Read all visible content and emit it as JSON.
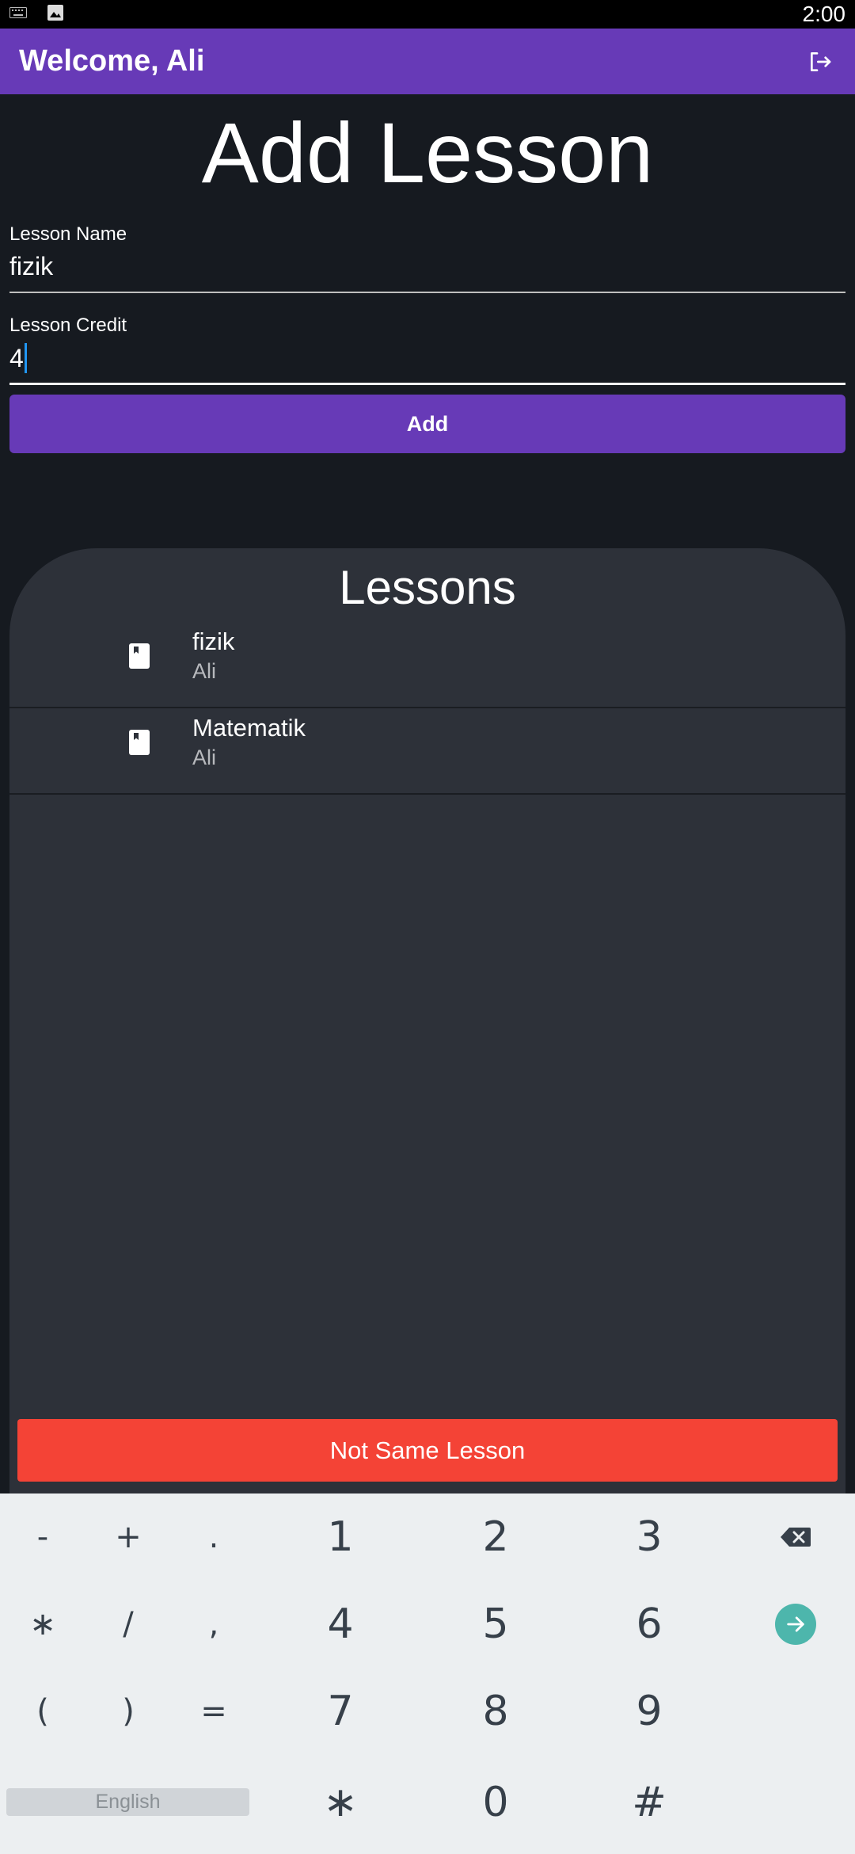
{
  "status_bar": {
    "time": "2:00",
    "icons": [
      "keyboard-icon",
      "image-icon"
    ]
  },
  "app_bar": {
    "title": "Welcome, Ali",
    "action_icon": "logout-icon",
    "color": "#673ab7"
  },
  "page": {
    "title": "Add Lesson"
  },
  "form": {
    "lesson_name": {
      "label": "Lesson Name",
      "value": "fizik"
    },
    "lesson_credit": {
      "label": "Lesson Credit",
      "value": "4"
    },
    "add_label": "Add"
  },
  "lessons_panel": {
    "title": "Lessons",
    "items": [
      {
        "name": "fizik",
        "owner": "Ali",
        "icon": "book-icon"
      },
      {
        "name": "Matematik",
        "owner": "Ali",
        "icon": "book-icon"
      }
    ],
    "action_label": "Not Same Lesson",
    "action_color": "#f44336"
  },
  "keyboard": {
    "row1": [
      "-",
      "+",
      ".",
      "1",
      "2",
      "3"
    ],
    "row2": [
      "∗",
      "/",
      ",",
      "4",
      "5",
      "6"
    ],
    "row3": [
      "(",
      ")",
      "=",
      "7",
      "8",
      "9"
    ],
    "row4": [
      "∗",
      "0",
      "#"
    ],
    "language": "English",
    "backspace_icon": "backspace-icon",
    "enter_icon": "arrow-right-icon"
  }
}
